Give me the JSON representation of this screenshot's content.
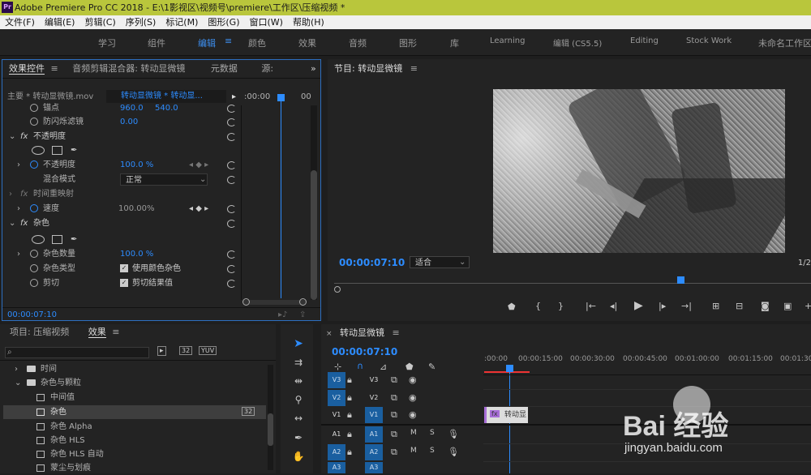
{
  "app": {
    "title": "Adobe Premiere Pro CC 2018 - E:\\1影视区\\视频号\\premiere\\工作区\\压缩视频 *",
    "logo": "Pr"
  },
  "menu": [
    "文件(F)",
    "编辑(E)",
    "剪辑(C)",
    "序列(S)",
    "标记(M)",
    "图形(G)",
    "窗口(W)",
    "帮助(H)"
  ],
  "workspaces": [
    "学习",
    "组件",
    "编辑",
    "颜色",
    "效果",
    "音频",
    "图形",
    "库",
    "Learning",
    "编辑 (CS5.5)",
    "Editing",
    "Stock Work",
    "未命名工作区"
  ],
  "effect_controls": {
    "tabs": [
      "效果控件",
      "音频剪辑混合器: 转动显微镜",
      "元数据",
      "源:"
    ],
    "master": "主要 * 转动显微镜.mov",
    "clip": "转动显微镜 * 转动显...",
    "ruler_time": ":00:00",
    "ruler_end": "00",
    "rows": [
      {
        "label": "锚点",
        "v1": "960.0",
        "v2": "540.0"
      },
      {
        "label": "防闪烁滤镜",
        "v1": "0.00"
      },
      {
        "label": "不透明度",
        "section": true
      },
      {
        "label": "不透明度",
        "v1": "100.0 %"
      },
      {
        "label": "混合模式",
        "v1": "正常"
      },
      {
        "label": "时间重映射",
        "section": true
      },
      {
        "label": "速度",
        "v1": "100.00%"
      },
      {
        "label": "杂色",
        "section": true
      },
      {
        "label": "杂色数量",
        "v1": "100.0 %"
      },
      {
        "label": "杂色类型",
        "v1": "使用颜色杂色"
      },
      {
        "label": "剪切",
        "v1": "剪切结果值"
      }
    ],
    "timecode": "00:00:07:10"
  },
  "program": {
    "title": "节目: 转动显微镜",
    "timecode": "00:00:07:10",
    "fit": "适合",
    "ratio": "1/2"
  },
  "project": {
    "tabs": [
      "项目: 压缩视频",
      "效果"
    ],
    "tree": [
      {
        "label": "时间",
        "type": "folder"
      },
      {
        "label": "杂色与颗粒",
        "type": "folder-open"
      },
      {
        "label": "中间值",
        "type": "fx"
      },
      {
        "label": "杂色",
        "type": "fx",
        "selected": true
      },
      {
        "label": "杂色 Alpha",
        "type": "fx"
      },
      {
        "label": "杂色 HLS",
        "type": "fx"
      },
      {
        "label": "杂色 HLS 自动",
        "type": "fx"
      },
      {
        "label": "蒙尘与划痕",
        "type": "fx"
      }
    ]
  },
  "timeline": {
    "title": "转动显微镜",
    "timecode": "00:00:07:10",
    "ticks": [
      ":00:00",
      "00:00:15:00",
      "00:00:30:00",
      "00:00:45:00",
      "00:01:00:00",
      "00:01:15:00",
      "00:01:30:"
    ],
    "video_tracks": [
      "V3",
      "V2",
      "V1"
    ],
    "audio_tracks": [
      "A1",
      "A2",
      "A3"
    ],
    "clip": "转动显"
  },
  "watermark": {
    "brand": "Bai 经验",
    "url": "jingyan.baidu.com"
  },
  "colors": {
    "accent": "#2d8cff",
    "title_bar": "#b9c63c"
  }
}
